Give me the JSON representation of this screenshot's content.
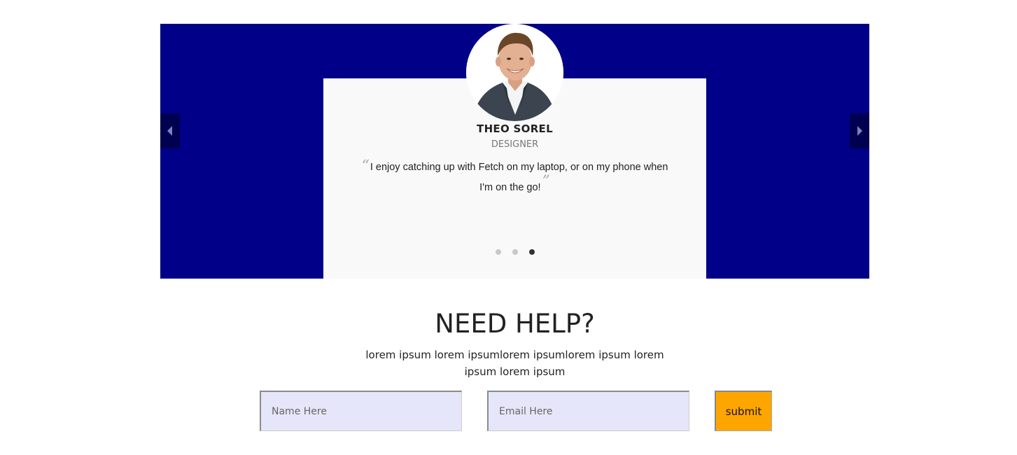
{
  "testimonial": {
    "prev_icon": "chevron-left-icon",
    "next_icon": "chevron-right-icon",
    "name": "THEO SOREL",
    "role": "DESIGNER",
    "quote_open": "“",
    "quote_text": "I enjoy catching up with Fetch on my laptop, or on my phone when I'm on the go!",
    "quote_close": "”",
    "slide_count": 3,
    "active_slide": 3,
    "band_color": "#000088"
  },
  "help": {
    "title": "NEED HELP?",
    "text": "lorem ipsum lorem ipsumlorem ipsumlorem ipsum lorem ipsum lorem ipsum",
    "name_placeholder": "Name Here",
    "email_placeholder": "Email Here",
    "submit_label": "submit",
    "submit_color": "#ffa500",
    "input_bg": "#e6e6fa"
  }
}
